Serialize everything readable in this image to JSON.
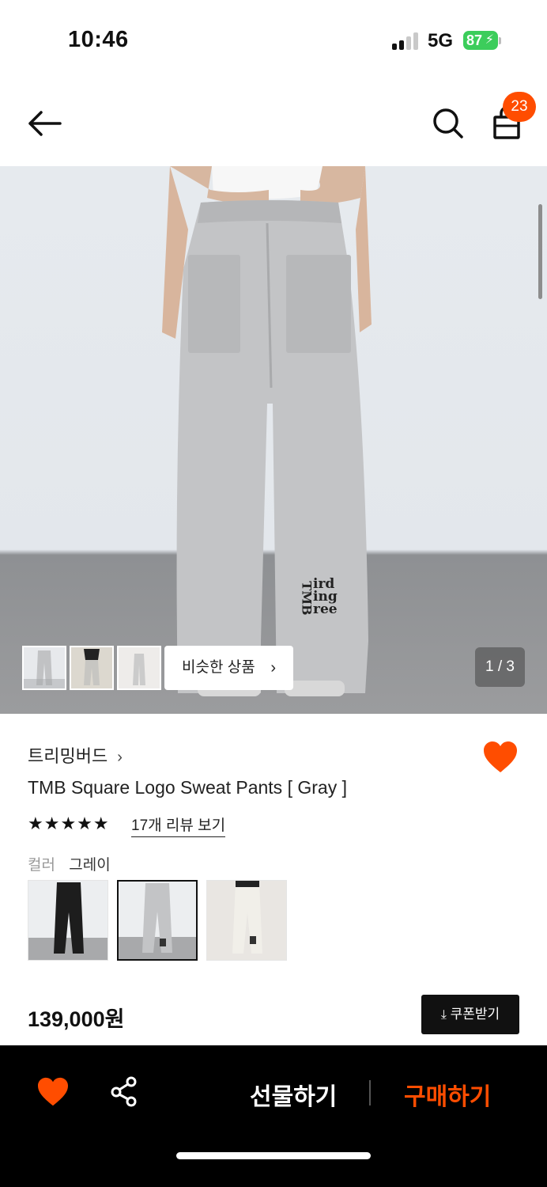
{
  "status_bar": {
    "time": "10:46",
    "network": "5G",
    "battery": "87"
  },
  "header": {
    "back_icon": "arrow-left-icon",
    "search_icon": "search-icon",
    "bag_icon": "shopping-bag-icon",
    "cart_count": "23"
  },
  "hero": {
    "similar_label": "비슷한 상품",
    "page_indicator": "1 / 3",
    "logo_text": [
      "TMB",
      "ird",
      "ing",
      "ree"
    ]
  },
  "product": {
    "brand": "트리밍버드",
    "title": "TMB Square Logo Sweat Pants [ Gray ]",
    "stars": "★★★★★",
    "rating": 5,
    "review_link": "17개 리뷰 보기",
    "color_label": "컬러",
    "color_value": "그레이",
    "swatches": [
      "black",
      "gray",
      "ivory"
    ],
    "price": "139,000원",
    "coupon_label": "쿠폰받기"
  },
  "bottom_bar": {
    "gift_label": "선물하기",
    "buy_label": "구매하기"
  },
  "colors": {
    "accent": "#ff4d00",
    "bottom_bar_bg": "#000000",
    "battery": "#3ccd5b"
  }
}
